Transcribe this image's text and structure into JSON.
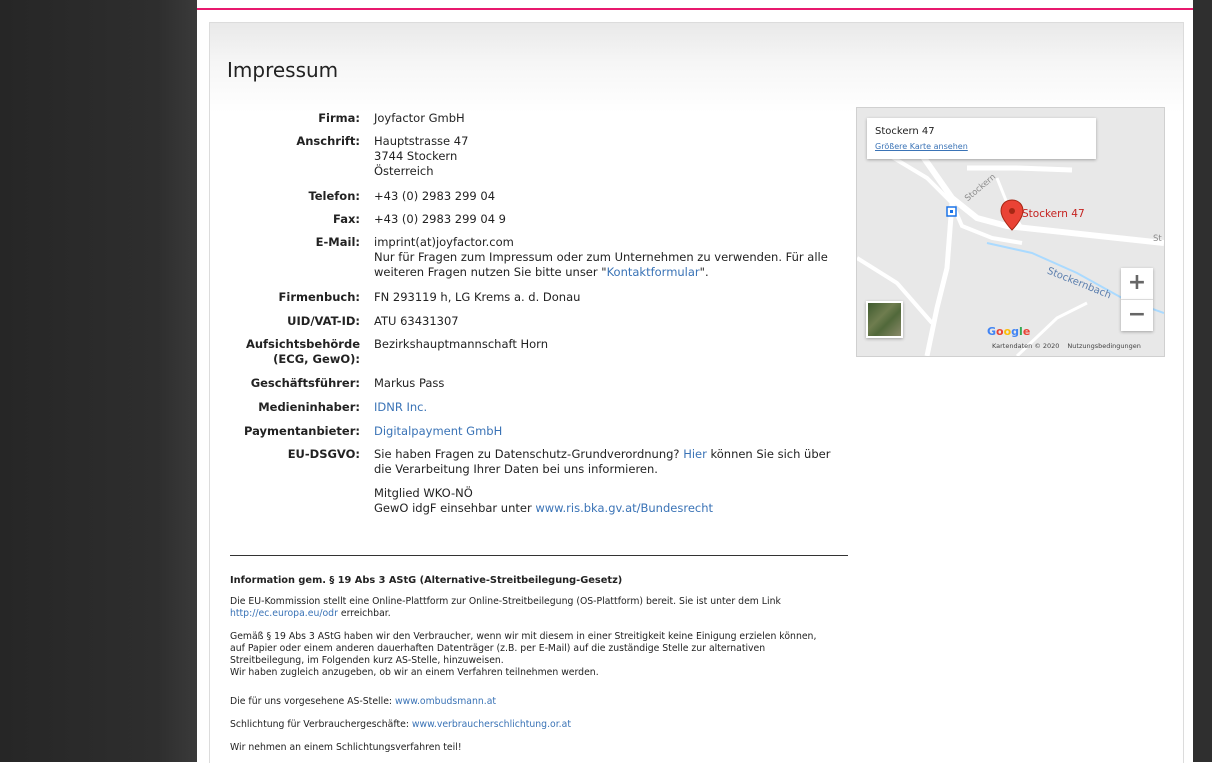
{
  "page": {
    "title": "Impressum"
  },
  "fields": [
    {
      "label": "Firma:",
      "lines": [
        "Joyfactor GmbH"
      ]
    },
    {
      "label": "Anschrift:",
      "lines": [
        "Hauptstrasse 47",
        "3744 Stockern",
        "Österreich"
      ]
    },
    {
      "label": "Telefon:",
      "lines": [
        "+43 (0) 2983 299 04"
      ]
    },
    {
      "label": "Fax:",
      "lines": [
        "+43 (0) 2983 299 04 9"
      ]
    },
    {
      "label": "E-Mail:",
      "lines": [
        "imprint(at)joyfactor.com"
      ],
      "note_before": "Nur für Fragen zum Impressum oder zum Unternehmen zu verwenden. Für alle",
      "note_line2_before": "weiteren Fragen nutzen Sie bitte unser \"",
      "note_link": "Kontaktformular",
      "note_after": "\"."
    },
    {
      "label": "Firmenbuch:",
      "lines": [
        "FN 293119 h, LG Krems a. d. Donau"
      ]
    },
    {
      "label": "UID/VAT-ID:",
      "lines": [
        "ATU 63431307"
      ]
    },
    {
      "label_line1": "Aufsichtsbehörde",
      "label_line2": "(ECG, GewO):",
      "lines": [
        "Bezirkshauptmannschaft Horn"
      ]
    },
    {
      "label": "Geschäftsführer:",
      "lines": [
        "Markus Pass"
      ]
    },
    {
      "label": "Medieninhaber:",
      "link": "IDNR Inc."
    },
    {
      "label": "Paymentanbieter:",
      "link": "Digitalpayment GmbH"
    },
    {
      "label": "EU-DSGVO:",
      "text_before": "Sie haben Fragen zu Datenschutz-Grundverordnung? ",
      "link": "Hier",
      "text_after": " können Sie sich über",
      "line2": "die Verarbeitung Ihrer Daten bei uns informieren."
    }
  ],
  "membership": {
    "line1": "Mitglied WKO-NÖ",
    "line2_before": "GewO idgF einsehbar unter ",
    "line2_link": "www.ris.bka.gv.at/Bundesrecht"
  },
  "astg": {
    "heading": "Information gem. § 19 Abs 3 AStG (Alternative-Streitbeilegung-Gesetz)",
    "p1_line1": "Die EU-Kommission stellt eine Online-Plattform zur Online-Streitbeilegung (OS-Plattform) bereit. Sie ist unter dem Link",
    "p1_link": "http://ec.europa.eu/odr",
    "p1_after": " erreichbar.",
    "p2_lines": [
      "Gemäß § 19 Abs 3 AStG haben wir den Verbraucher, wenn wir mit diesem in einer Streitigkeit keine Einigung erzielen können,",
      "auf Papier oder einem anderen dauerhaften Datenträger (z.B. per E-Mail) auf die zuständige Stelle zur alternativen",
      "Streitbeilegung, im Folgenden kurz AS-Stelle, hinzuweisen.",
      "Wir haben zugleich anzugeben, ob wir an einem Verfahren teilnehmen werden."
    ],
    "p3_before": "Die für uns vorgesehene AS-Stelle: ",
    "p3_link": "www.ombudsmann.at",
    "p4_before": "Schlichtung für Verbrauchergeschäfte: ",
    "p4_link": "www.verbraucherschlichtung.or.at",
    "p5": "Wir nehmen an einem Schlichtungsverfahren teil!"
  },
  "map": {
    "card_title": "Stockern 47",
    "card_link": "Größere Karte ansehen",
    "pin_label": "Stockern 47",
    "road_label": "Stockern",
    "road_label_edge": "St",
    "river_label": "Stockernbach",
    "zoom_in": "+",
    "zoom_out": "−",
    "google": "Google",
    "footer_data": "Kartendaten © 2020",
    "footer_terms": "Nutzungsbedingungen",
    "pin_color": "#ea4335",
    "water_color": "#aadaff"
  },
  "colors": {
    "accent": "#e8196e",
    "link": "#3a73b6"
  }
}
